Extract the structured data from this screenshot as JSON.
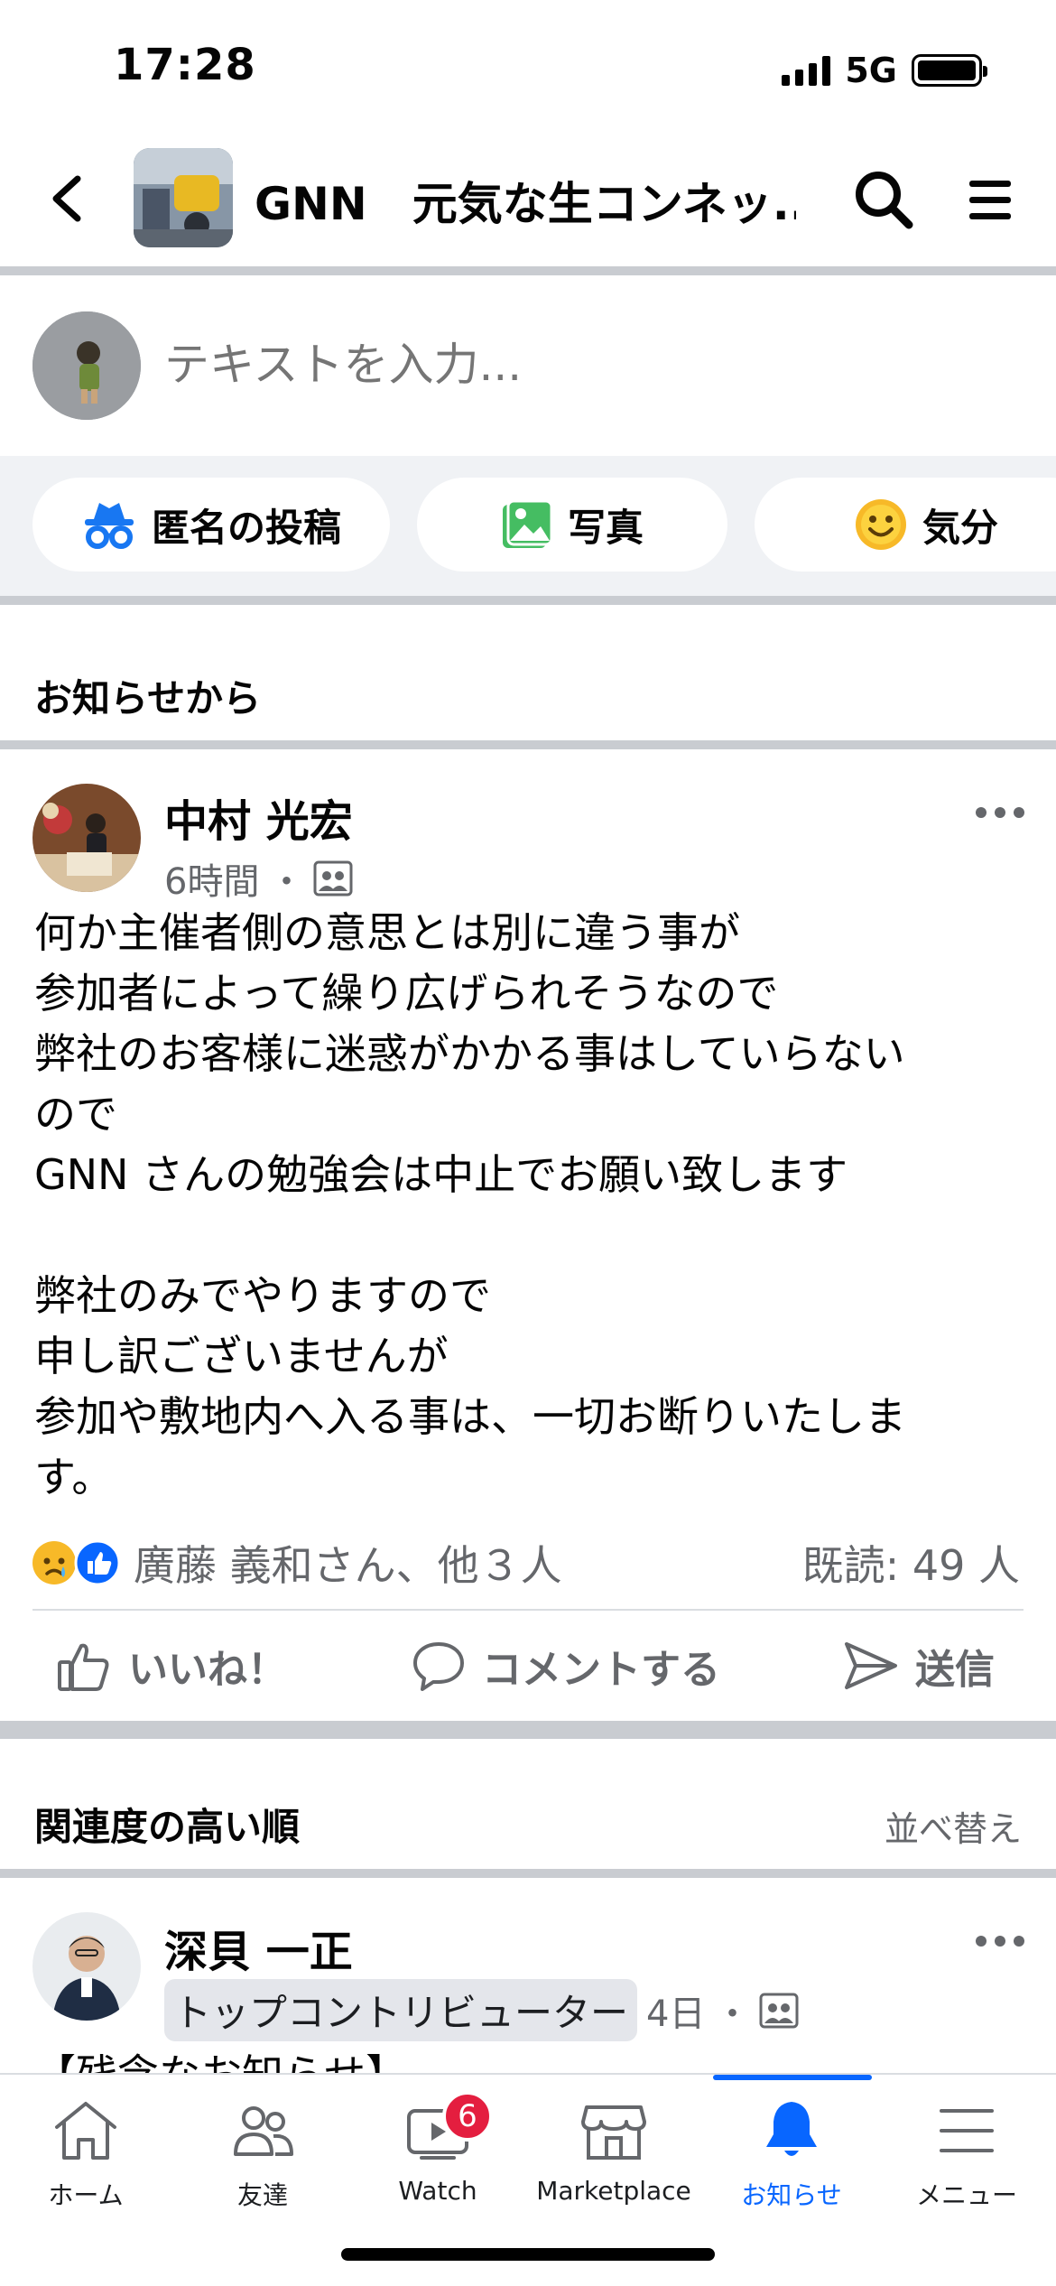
{
  "status_bar": {
    "time": "17:28",
    "network": "5G"
  },
  "header": {
    "title": "GNN　元気な生コンネッ..."
  },
  "composer": {
    "placeholder": "テキストを入力..."
  },
  "chips": {
    "anonymous": "匿名の投稿",
    "photo": "写真",
    "feeling": "気分"
  },
  "sections": {
    "announcements": "お知らせから",
    "relevance": "関連度の高い順",
    "sort": "並べ替え"
  },
  "post": {
    "author": "中村 光宏",
    "time": "6時間",
    "body": "何か主催者側の意思とは別に違う事が\n参加者によって繰り広げられそうなので\n弊社のお客様に迷惑がかかる事はしていらない\nので\nGNN さんの勉強会は中止でお願い致します\n\n弊社のみでやりますので\n申し訳ございませんが\n参加や敷地内へ入る事は、一切お断りいたしま\nす。",
    "reactions": "廣藤 義和さん、他３人",
    "seen": "既読: 49 人",
    "actions": {
      "like": "いいね！",
      "comment": "コメントする",
      "send": "送信"
    }
  },
  "post2": {
    "author": "深貝 一正",
    "role": "トップコントリビューター",
    "time": "4日",
    "body_preview": "【残念なお知らせ】"
  },
  "bottom_nav": {
    "home": "ホーム",
    "friends": "友達",
    "watch": "Watch",
    "watch_badge": "6",
    "marketplace": "Marketplace",
    "notifications": "お知らせ",
    "menu": "メニュー"
  },
  "colors": {
    "accent": "#0866ff",
    "badge": "#e41e3f",
    "divider": "#c9ccd1"
  }
}
